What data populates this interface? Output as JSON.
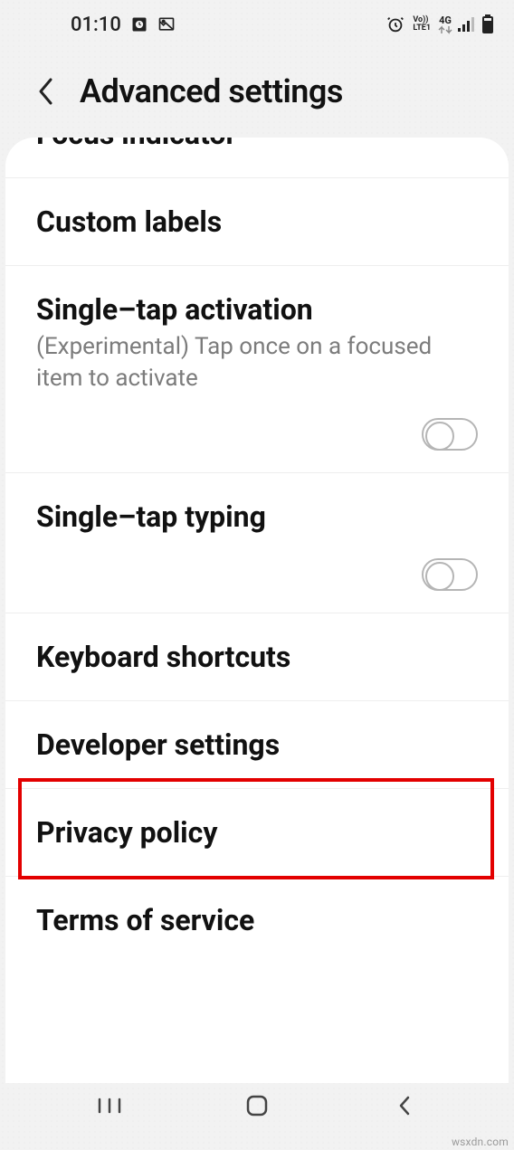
{
  "status": {
    "time": "01:10",
    "network_label_top": "Vo))",
    "network_label_bottom": "LTE1",
    "network_data": "4G"
  },
  "header": {
    "title": "Advanced settings"
  },
  "items": {
    "focus_indicator": {
      "title": "Focus indicator"
    },
    "custom_labels": {
      "title": "Custom labels"
    },
    "single_tap_activation": {
      "title": "Single–tap activation",
      "subtitle": "(Experimental) Tap once on a focused item to activate"
    },
    "single_tap_typing": {
      "title": "Single–tap typing"
    },
    "keyboard_shortcuts": {
      "title": "Keyboard shortcuts"
    },
    "developer_settings": {
      "title": "Developer settings"
    },
    "privacy_policy": {
      "title": "Privacy policy"
    },
    "terms_of_service": {
      "title": "Terms of service"
    }
  },
  "watermark": "wsxdn.com"
}
